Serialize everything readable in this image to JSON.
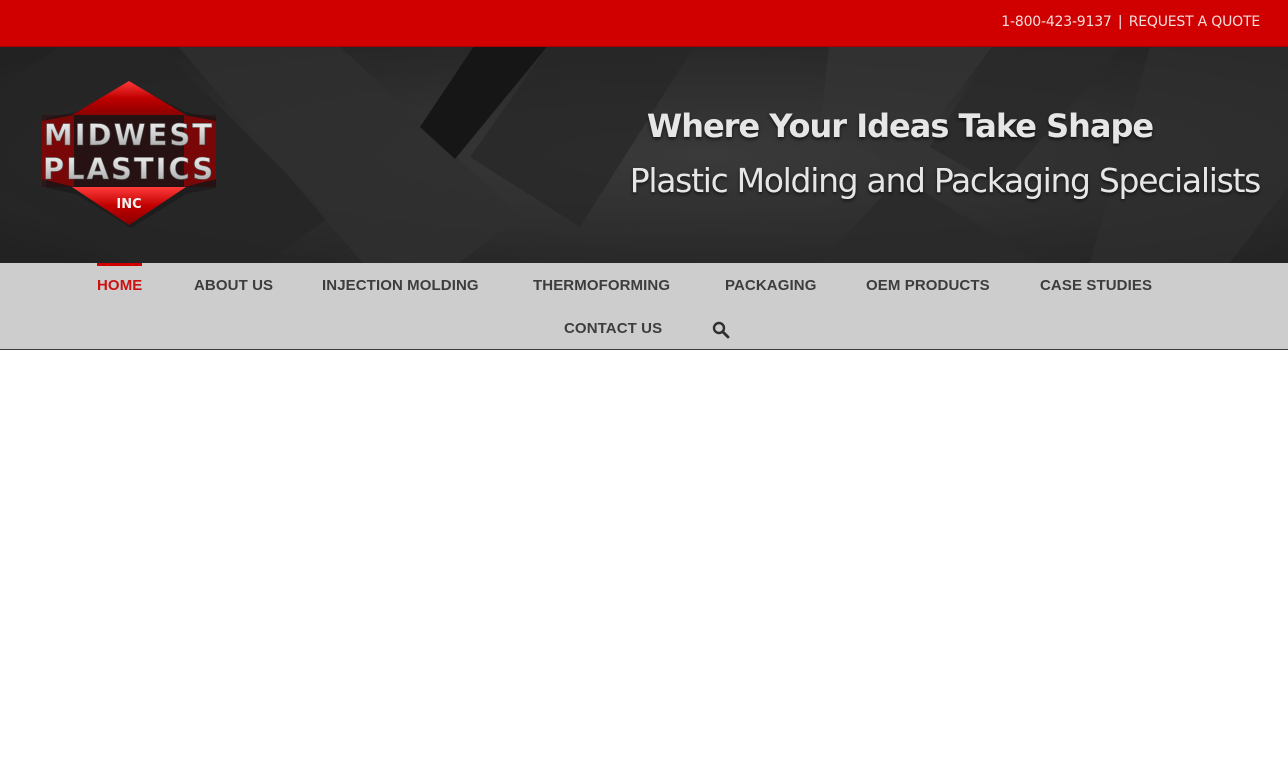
{
  "topbar": {
    "phone": "1-800-423-9137",
    "separator": "|",
    "quote_link": "REQUEST A QUOTE"
  },
  "logo": {
    "line1": "MIDWEST",
    "line2": "PLASTICS",
    "line3": "INC"
  },
  "hero": {
    "tagline": "Where Your Ideas Take Shape",
    "subtagline": "Plastic Molding and Packaging Specialists"
  },
  "nav": {
    "items": [
      {
        "label": "HOME",
        "active": true
      },
      {
        "label": "ABOUT US"
      },
      {
        "label": "INJECTION MOLDING"
      },
      {
        "label": "THERMOFORMING"
      },
      {
        "label": "PACKAGING"
      },
      {
        "label": "OEM PRODUCTS"
      },
      {
        "label": "CASE STUDIES"
      },
      {
        "label": "CONTACT US"
      }
    ],
    "search_icon": "search-icon"
  },
  "colors": {
    "brand_red": "#d10000",
    "nav_bg": "#cdcdcd",
    "hero_bg": "#2b2b2b"
  }
}
